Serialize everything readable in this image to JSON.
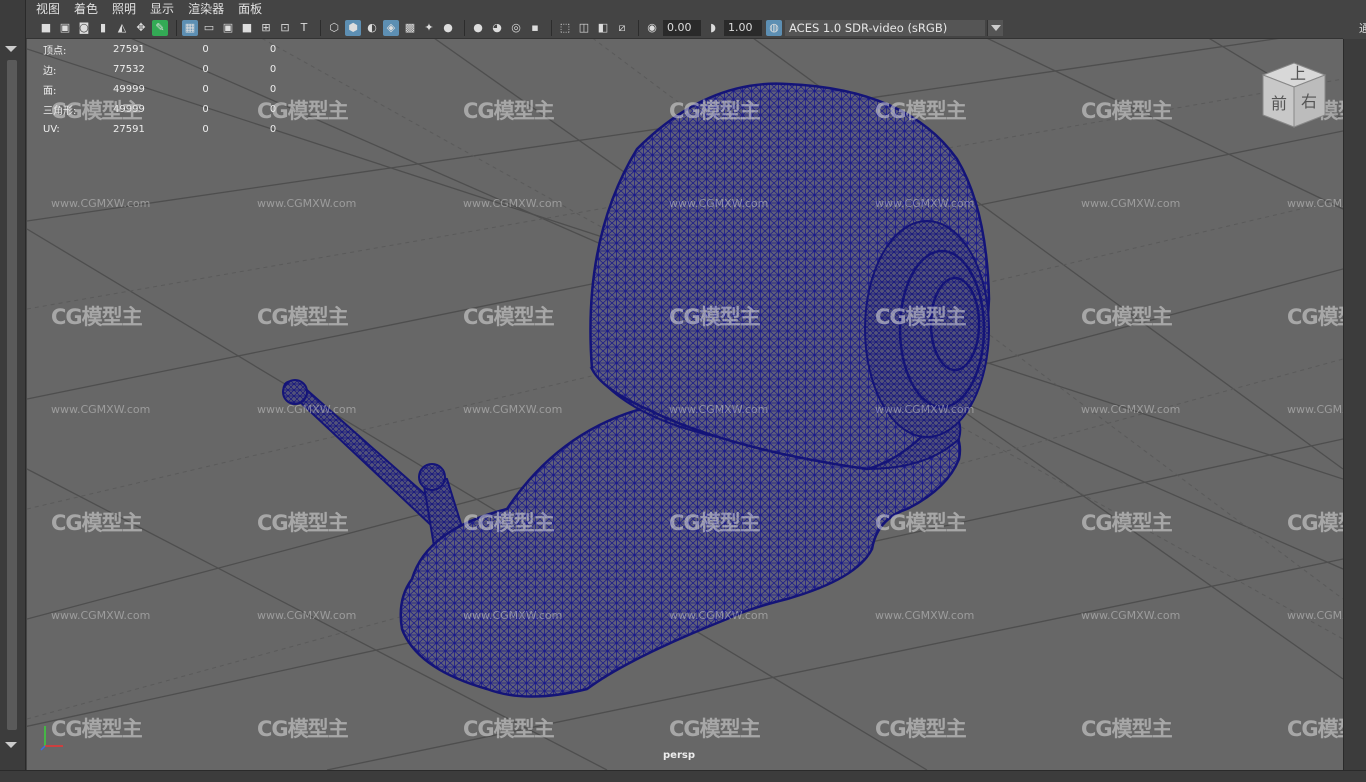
{
  "menu": [
    "视图",
    "着色",
    "照明",
    "显示",
    "渲染器",
    "面板"
  ],
  "toolbar": {
    "exposure_value": "0.00",
    "gamma_value": "1.00",
    "color_space": "ACES 1.0 SDR-video (sRGB)"
  },
  "hud": {
    "rows": [
      {
        "label": "顶点:",
        "v1": "27591",
        "v2": "0",
        "v3": "0"
      },
      {
        "label": "边:",
        "v1": "77532",
        "v2": "0",
        "v3": "0"
      },
      {
        "label": "面:",
        "v1": "49999",
        "v2": "0",
        "v3": "0"
      },
      {
        "label": "三角形:",
        "v1": "49999",
        "v2": "0",
        "v3": "0"
      },
      {
        "label": "UV:",
        "v1": "27591",
        "v2": "0",
        "v3": "0"
      }
    ]
  },
  "viewcube": {
    "top": "上",
    "front": "前",
    "right": "右"
  },
  "camera_label": "persp",
  "watermark": {
    "logo": "CG模型主",
    "url": "www.CGMXW.com"
  },
  "right_top_glyph": "通",
  "colors": {
    "wire": "#141478",
    "viewport_bg": "#676767",
    "accent": "#5d8fb3"
  }
}
